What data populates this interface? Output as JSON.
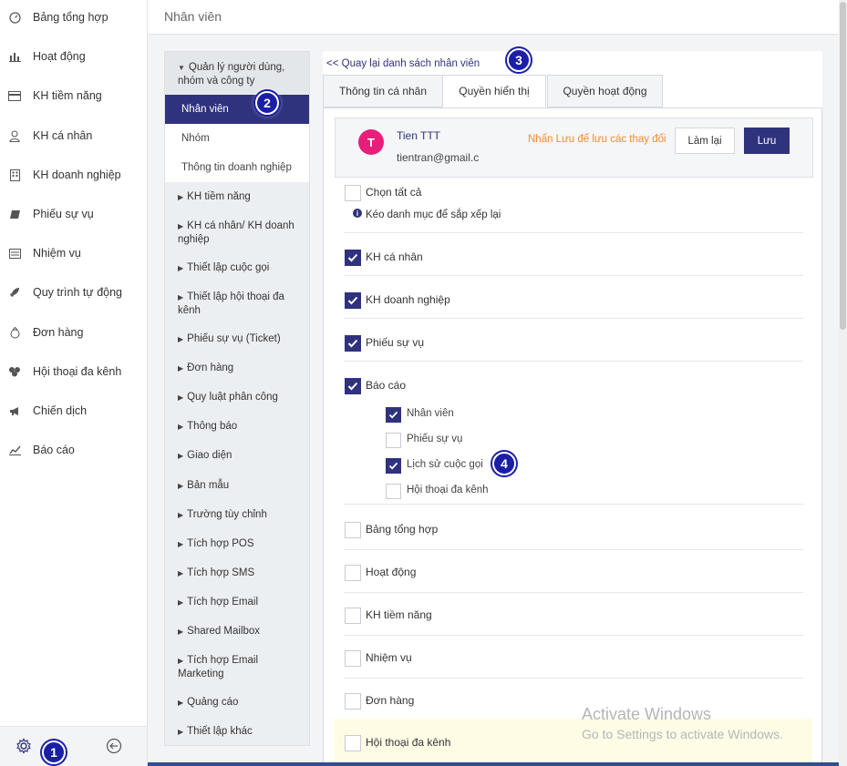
{
  "sidebar": {
    "items": [
      {
        "label": "Bảng tổng hợp",
        "icon": "dashboard-icon"
      },
      {
        "label": "Hoạt động",
        "icon": "activity-icon"
      },
      {
        "label": "KH tiềm năng",
        "icon": "lead-card-icon"
      },
      {
        "label": "KH cá nhân",
        "icon": "person-icon"
      },
      {
        "label": "KH doanh nghiệp",
        "icon": "building-icon"
      },
      {
        "label": "Phiếu sự vụ",
        "icon": "ticket-icon"
      },
      {
        "label": "Nhiệm vụ",
        "icon": "task-icon"
      },
      {
        "label": "Quy trình tự động",
        "icon": "rocket-icon"
      },
      {
        "label": "Đơn hàng",
        "icon": "order-icon"
      },
      {
        "label": "Hội thoại đa kênh",
        "icon": "omnichannel-icon"
      },
      {
        "label": "Chiến dịch",
        "icon": "megaphone-icon"
      },
      {
        "label": "Báo cáo",
        "icon": "report-icon"
      }
    ],
    "footer": {
      "settings_icon": "gear-icon",
      "collapse_icon": "arrow-left-circle-icon"
    }
  },
  "header": {
    "title": "Nhân viên"
  },
  "settings_menu": {
    "group": {
      "label": "Quản lý người dùng, nhóm và công ty",
      "children": [
        "Nhân viên",
        "Nhóm",
        "Thông tin doanh nghiệp"
      ],
      "active": "Nhân viên"
    },
    "items": [
      "KH tiềm năng",
      "KH cá nhân/ KH doanh nghiệp",
      "Thiết lập cuộc gọi",
      "Thiết lập hội thoại đa kênh",
      "Phiếu sự vụ (Ticket)",
      "Đơn hàng",
      "Quy luật phân công",
      "Thông báo",
      "Giao diện",
      "Bản mẫu",
      "Trường tùy chỉnh",
      "Tích hợp POS",
      "Tích hợp SMS",
      "Tích hợp Email",
      "Shared Mailbox",
      "Tích hợp Email Marketing",
      "Quảng cáo",
      "Thiết lập khác"
    ]
  },
  "main": {
    "back_link": "<< Quay lại danh sách nhân viên",
    "tabs": [
      {
        "label": "Thông tin cá nhân",
        "active": false
      },
      {
        "label": "Quyền hiển thị",
        "active": true
      },
      {
        "label": "Quyền hoạt động",
        "active": false
      }
    ],
    "user": {
      "initial": "T",
      "name": "Tien TTT",
      "email": "tientran@gmail.c"
    },
    "save_hint": "Nhấn Lưu để lưu các thay đổi",
    "reset_label": "Làm lại",
    "save_label": "Lưu",
    "select_all": {
      "label": "Chọn tất cả",
      "checked": false
    },
    "drag_hint": "Kéo danh mục để sắp xếp lại",
    "permissions": [
      {
        "label": "KH cá nhân",
        "checked": true
      },
      {
        "label": "KH doanh nghiệp",
        "checked": true
      },
      {
        "label": "Phiếu sự vụ",
        "checked": true
      },
      {
        "label": "Báo cáo",
        "checked": true,
        "children": [
          {
            "label": "Nhân viên",
            "checked": true
          },
          {
            "label": "Phiếu sự vụ",
            "checked": false
          },
          {
            "label": "Lịch sử cuộc gọi",
            "checked": true
          },
          {
            "label": "Hội thoại đa kênh",
            "checked": false
          }
        ]
      },
      {
        "label": "Bảng tổng hợp",
        "checked": false
      },
      {
        "label": "Hoạt động",
        "checked": false
      },
      {
        "label": "KH tiềm năng",
        "checked": false
      },
      {
        "label": "Nhiệm vụ",
        "checked": false
      },
      {
        "label": "Đơn hàng",
        "checked": false
      },
      {
        "label": "Hội thoại đa kênh",
        "checked": false
      }
    ]
  },
  "annotations": [
    "1",
    "2",
    "3",
    "4"
  ],
  "watermark": {
    "title": "Activate Windows",
    "subtitle": "Go to Settings to activate Windows."
  },
  "colors": {
    "primary": "#2f327d",
    "avatar": "#e91e7a",
    "hint": "#f08c2e",
    "badge": "#1a1fa6"
  }
}
